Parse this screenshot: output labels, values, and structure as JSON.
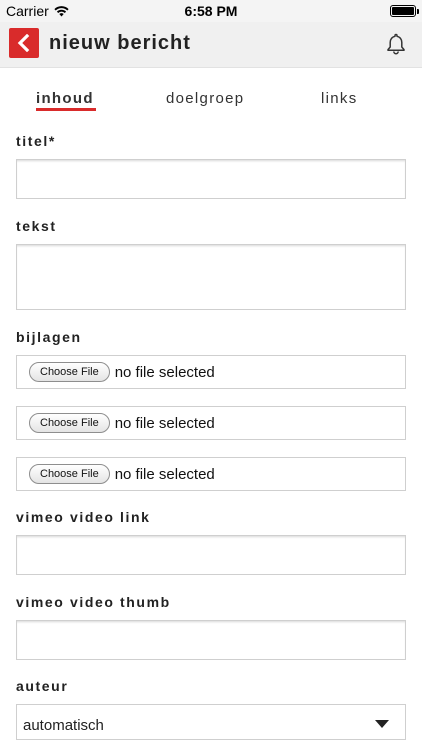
{
  "status_bar": {
    "carrier": "Carrier",
    "time": "6:58 PM"
  },
  "header": {
    "title": "nieuw bericht"
  },
  "tabs": [
    {
      "label": "inhoud",
      "active": true
    },
    {
      "label": "doelgroep",
      "active": false
    },
    {
      "label": "links",
      "active": false
    }
  ],
  "form": {
    "titel": {
      "label": "titel*",
      "value": ""
    },
    "tekst": {
      "label": "tekst",
      "value": ""
    },
    "bijlagen": {
      "label": "bijlagen",
      "files": [
        {
          "button": "Choose File",
          "status": "no file selected"
        },
        {
          "button": "Choose File",
          "status": "no file selected"
        },
        {
          "button": "Choose File",
          "status": "no file selected"
        }
      ]
    },
    "vimeo_link": {
      "label": "vimeo video link",
      "value": ""
    },
    "vimeo_thumb": {
      "label": "vimeo video thumb",
      "value": ""
    },
    "auteur": {
      "label": "auteur",
      "selected": "automatisch"
    }
  },
  "colors": {
    "accent": "#d92b2b",
    "header_bg": "#f0f0f0",
    "text": "#222222"
  }
}
